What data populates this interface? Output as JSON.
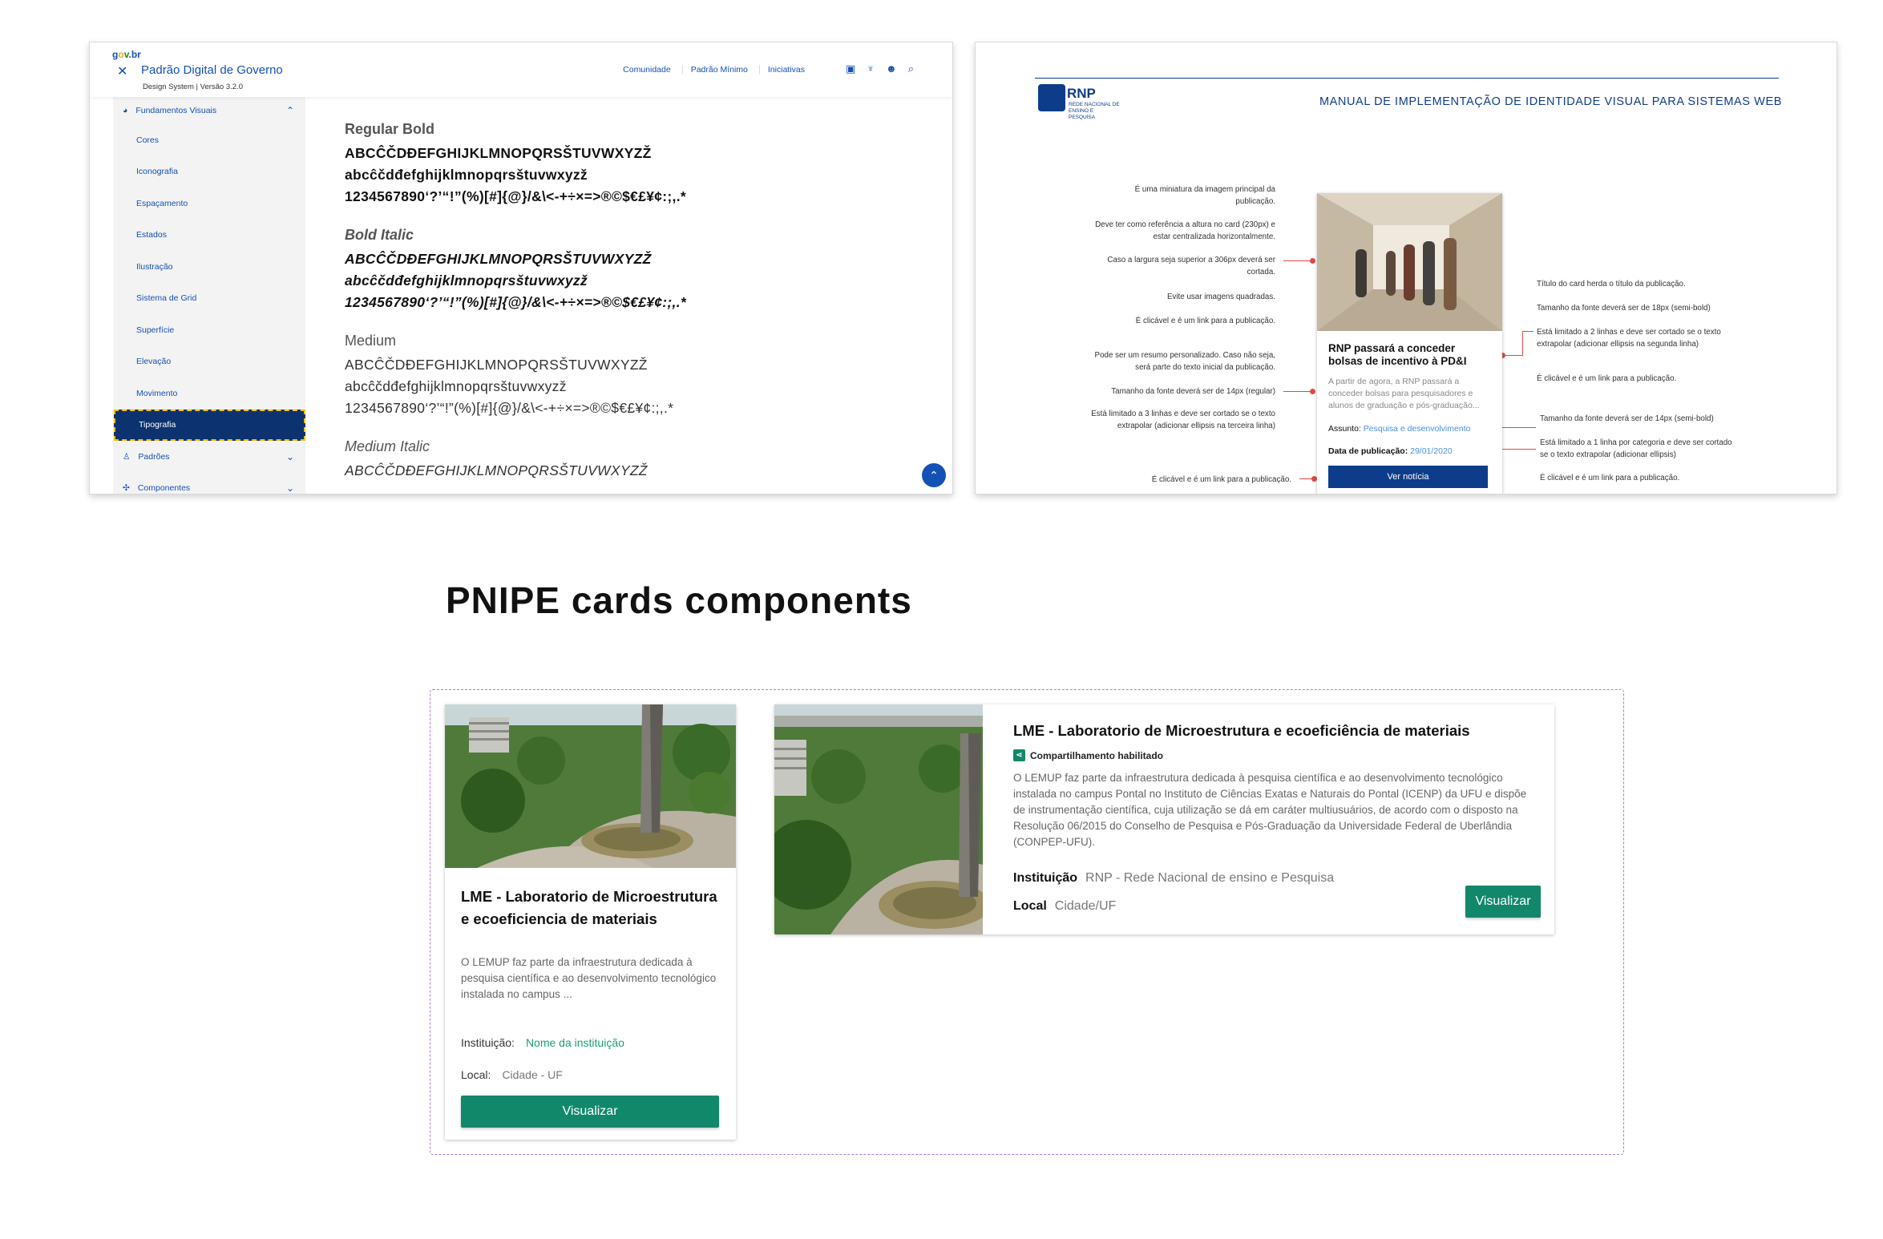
{
  "govbr": {
    "logo": {
      "g": "g",
      "o": "o",
      "v": "v",
      "br": ".br"
    },
    "title": "Padrão Digital de Governo",
    "subtitle": "Design System | Versão 3.2.0",
    "nav": [
      "Comunidade",
      "Padrão Mínimo",
      "Iniciativas"
    ],
    "sidebar": {
      "group_open": "Fundamentos Visuais",
      "items": [
        "Cores",
        "Iconografia",
        "Espaçamento",
        "Estados",
        "Ilustração",
        "Sistema de Grid",
        "Superfície",
        "Elevação",
        "Movimento",
        "Tipografia"
      ],
      "group_padroes": "Padrões",
      "group_componentes": "Componentes"
    },
    "typography": {
      "regular_bold": {
        "label": "Regular Bold",
        "l1": "ABCĈČDĐEFGHIJKLMNOPQRSŠTUVWXYZŽ",
        "l2": "abcĉčdđefghijklmnopqrsštuvwxyzž",
        "l3": "1234567890‘?’“!”(%)[#]{@}/&\\<-+÷×=>®©$€£¥¢:;,.*"
      },
      "bold_italic": {
        "label": "Bold Italic",
        "l1": "ABCĈČDĐEFGHIJKLMNOPQRSŠTUVWXYZŽ",
        "l2": "abcĉčdđefghijklmnopqrsštuvwxyzž",
        "l3": "1234567890‘?’“!”(%)[#]{@}/&\\<-+÷×=>®©$€£¥¢:;,.*"
      },
      "medium": {
        "label": "Medium",
        "l1": "ABCĈČDĐEFGHIJKLMNOPQRSŠTUVWXYZŽ",
        "l2": "abcĉčdđefghijklmnopqrsštuvwxyzž",
        "l3": "1234567890‘?’“!”(%)[#]{@}/&\\<-+÷×=>®©$€£¥¢:;,.*"
      },
      "medium_italic": {
        "label": "Medium Italic",
        "l1": "ABCĈČDĐEFGHIJKLMNOPQRSŠTUVWXYZŽ"
      }
    }
  },
  "rnp": {
    "logo_main": "RNP",
    "logo_sub": "REDE NACIONAL DE ENSINO E PESQUISA",
    "header": "MANUAL DE IMPLEMENTAÇÃO DE IDENTIDADE VISUAL PARA SISTEMAS WEB",
    "left_notes": [
      "É uma miniatura da imagem principal da publicação.",
      "Deve ter como referência a altura no card (230px) e estar centralizada horizontalmente.",
      "Caso a largura seja superior a 306px deverá ser cortada.",
      "Evite usar imagens quadradas.",
      "É clicável e é um link para a publicação.",
      "Pode ser um resumo personalizado. Caso não seja, será parte do texto inicial da publicação.",
      "Tamanho da fonte deverá ser de 14px (regular)",
      "Está limitado a 3 linhas e deve ser cortado se o texto extrapolar (adicionar ellipsis na terceira linha)",
      "É clicável e é um link para a publicação."
    ],
    "right_notes": [
      "Título do card herda o título da publicação.",
      "Tamanho da fonte deverá ser de 18px (semi-bold)",
      "Está limitado a 2 linhas e deve ser cortado se o texto extrapolar (adicionar ellipsis na segunda linha)",
      "É clicável e é um link para a publicação.",
      "Tamanho da fonte deverá ser de 14px (semi-bold)",
      "Está limitado a 1 linha por categoria e deve ser cortado se o texto extrapolar (adicionar ellipsis)",
      "É clicável e é um link para a publicação."
    ],
    "card": {
      "title": "RNP passará a conceder bolsas de incentivo à PD&I",
      "text": "A partir de agora, a RNP passará a conceder bolsas para pesquisadores e alunos de graduação e pós-graduação...",
      "subject_label": "Assunto:",
      "subject_value": "Pesquisa e desenvolvimento",
      "date_label": "Data de publicação:",
      "date_value": "29/01/2020",
      "button": "Ver notícia"
    }
  },
  "heading": "PNIPE cards components",
  "card_vertical": {
    "title": "LME - Laboratorio de Microestrutura e ecoeficiencia de materiais",
    "description": "O LEMUP faz parte da infraestrutura dedicada à pesquisa científica e ao desenvolvimento tecnológico instalada no campus ...",
    "institution_label": "Instituição:",
    "institution_value": "Nome da instituição",
    "local_label": "Local:",
    "local_value": "Cidade - UF",
    "button": "Visualizar"
  },
  "card_horizontal": {
    "title": "LME - Laboratorio de Microestrutura e ecoeficiência de materiais",
    "share": "Compartilhamento habilitado",
    "description": "O LEMUP faz parte da infraestrutura dedicada à pesquisa científica e ao desenvolvimento tecnológico instalada no campus Pontal no Instituto de Ciências Exatas e Naturais do Pontal (ICENP) da UFU e dispõe de instrumentação científica, cuja utilização se dá em caráter multiusuários, de acordo com o disposto na Resolução 06/2015 do Conselho de Pesquisa e Pós-Graduação da Universidade Federal de Uberlândia (CONPEP-UFU).",
    "institution_label": "Instituição",
    "institution_value": "RNP - Rede Nacional de ensino e Pesquisa",
    "local_label": "Local",
    "local_value": "Cidade/UF",
    "button": "Visualizar"
  },
  "colors": {
    "govbr_blue": "#1351b4",
    "rnp_blue": "#0d3c8a",
    "pnipe_green": "#12886a",
    "frame_purple": "#a97de6",
    "note_red": "#e04848"
  }
}
